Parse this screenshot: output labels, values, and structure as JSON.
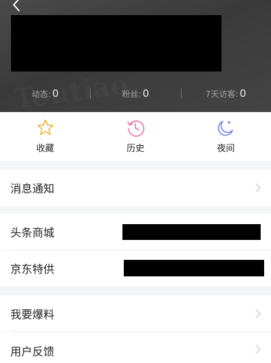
{
  "header": {
    "stats": [
      {
        "label": "动态:",
        "value": "0"
      },
      {
        "label": "粉丝:",
        "value": "0"
      },
      {
        "label": "7天访客:",
        "value": "0"
      }
    ]
  },
  "shortcuts": [
    {
      "label": "收藏",
      "icon": "star-icon",
      "color": "#f2b233"
    },
    {
      "label": "历史",
      "icon": "history-icon",
      "color": "#ef6ea0"
    },
    {
      "label": "夜间",
      "icon": "moon-icon",
      "color": "#6f86e6"
    }
  ],
  "menu": {
    "notifications": "消息通知",
    "toutiao_mall": "头条商城",
    "jd_special": "京东特供",
    "report_news": "我要爆料",
    "user_feedback": "用户反馈"
  }
}
